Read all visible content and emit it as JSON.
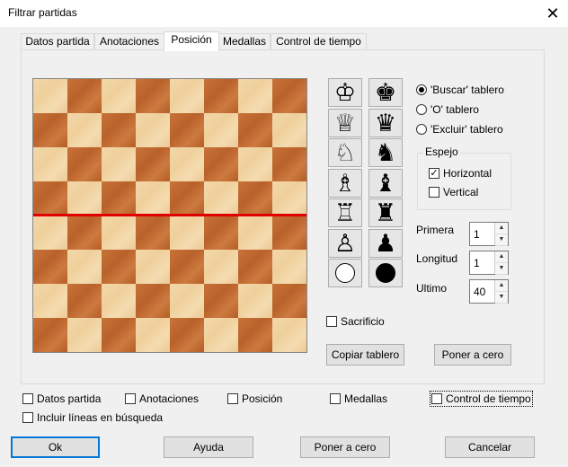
{
  "window": {
    "title": "Filtrar partidas",
    "close_glyph": "✕"
  },
  "tabs": [
    {
      "label": "Datos partida"
    },
    {
      "label": "Anotaciones"
    },
    {
      "label": "Posición",
      "active": true
    },
    {
      "label": "Medallas"
    },
    {
      "label": "Control de tiempo"
    }
  ],
  "pieces": {
    "white": [
      "♔",
      "♕",
      "♘",
      "♗",
      "♖",
      "♙"
    ],
    "black": [
      "♚",
      "♛",
      "♞",
      "♝",
      "♜",
      "♟"
    ],
    "icons_white": [
      "white-king-icon",
      "white-queen-icon",
      "white-knight-icon",
      "white-bishop-icon",
      "white-rook-icon",
      "white-pawn-icon",
      "white-circle-icon"
    ],
    "icons_black": [
      "black-king-icon",
      "black-queen-icon",
      "black-knight-icon",
      "black-bishop-icon",
      "black-rook-icon",
      "black-pawn-icon",
      "black-circle-icon"
    ]
  },
  "board": {
    "light_color": "#f0d3a2",
    "dark_color": "#c06a33",
    "marker_color": "#e00000"
  },
  "mode": {
    "options": [
      "'Buscar' tablero",
      "'O' tablero",
      "'Excluir' tablero"
    ],
    "selected": 0
  },
  "mirror": {
    "label": "Espejo",
    "horizontal": {
      "label": "Horizontal",
      "checked": true
    },
    "vertical": {
      "label": "Vertical",
      "checked": false
    }
  },
  "fields": {
    "primera": {
      "label": "Primera",
      "value": "1"
    },
    "longitud": {
      "label": "Longitud",
      "value": "1"
    },
    "ultimo": {
      "label": "Ultimo",
      "value": "40"
    }
  },
  "sacrificio": {
    "label": "Sacrificio",
    "checked": false
  },
  "panel_buttons": {
    "copy": "Copiar tablero",
    "reset": "Poner a cero"
  },
  "filters": [
    {
      "label": "Datos partida",
      "checked": false
    },
    {
      "label": "Anotaciones",
      "checked": false
    },
    {
      "label": "Posición",
      "checked": false
    },
    {
      "label": "Medallas",
      "checked": false
    },
    {
      "label": "Control de tiempo",
      "checked": false
    }
  ],
  "include_lines": {
    "label": "Incluir líneas en búsqueda",
    "checked": false
  },
  "footer": {
    "ok": "Ok",
    "help": "Ayuda",
    "reset": "Poner a cero",
    "cancel": "Cancelar"
  },
  "accent": "#0078d7"
}
